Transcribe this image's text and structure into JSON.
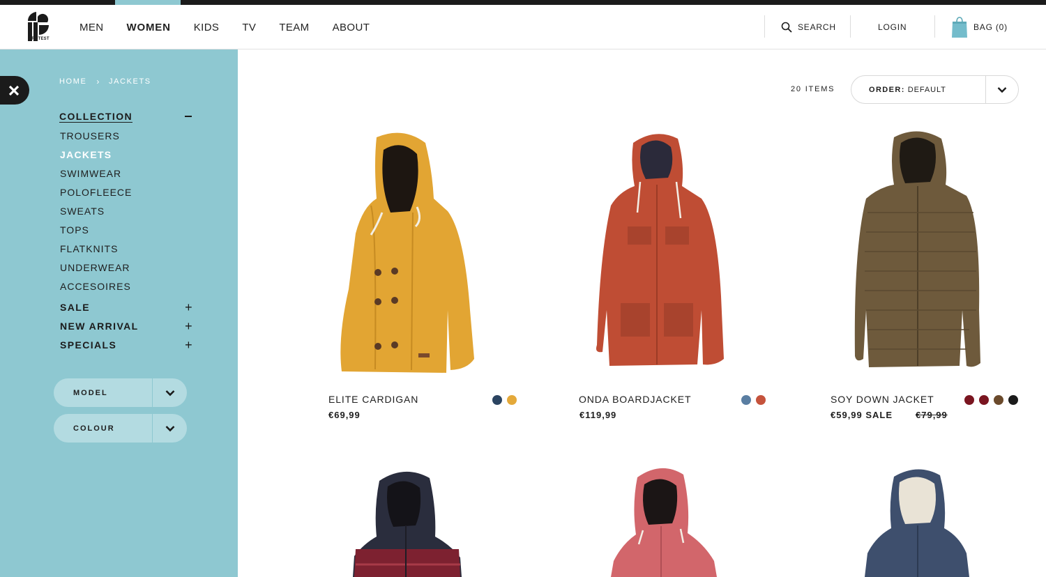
{
  "brand": {
    "name": "PROTEST"
  },
  "nav": {
    "items": [
      {
        "label": "MEN"
      },
      {
        "label": "WOMEN"
      },
      {
        "label": "KIDS"
      },
      {
        "label": "TV"
      },
      {
        "label": "TEAM"
      },
      {
        "label": "ABOUT"
      }
    ],
    "active": "WOMEN"
  },
  "header": {
    "search_label": "SEARCH",
    "login_label": "LOGIN",
    "bag_label": "BAG (0)"
  },
  "sidebar": {
    "breadcrumb": {
      "home": "HOME",
      "separator": "›",
      "current": "JACKETS"
    },
    "collection": {
      "label": "COLLECTION",
      "items": [
        {
          "label": "TROUSERS"
        },
        {
          "label": "JACKETS",
          "active": true
        },
        {
          "label": "SWIMWEAR"
        },
        {
          "label": "POLOFLEECE"
        },
        {
          "label": "SWEATS"
        },
        {
          "label": "TOPS"
        },
        {
          "label": "FLATKNITS"
        },
        {
          "label": "UNDERWEAR"
        },
        {
          "label": "ACCESOIRES"
        }
      ]
    },
    "categories": [
      {
        "label": "SALE",
        "toggle": "+"
      },
      {
        "label": "NEW ARRIVAL",
        "toggle": "+"
      },
      {
        "label": "SPECIALS",
        "toggle": "+"
      }
    ],
    "filters": [
      {
        "label": "MODEL"
      },
      {
        "label": "COLOUR"
      }
    ]
  },
  "listing": {
    "count_label": "20 ITEMS",
    "order": {
      "prefix": "ORDER:",
      "value": "DEFAULT"
    }
  },
  "products": [
    {
      "name": "ELITE CARDIGAN",
      "price": "€69,99",
      "image": "mustard-hooded-cardigan",
      "color": "#e2a533",
      "swatches": [
        "#2b4461",
        "#e4a93a"
      ]
    },
    {
      "name": "ONDA BOARDJACKET",
      "price": "€119,99",
      "image": "rust-boardjacket",
      "color": "#bf4d34",
      "swatches": [
        "#5a7ea2",
        "#c5533c"
      ]
    },
    {
      "name": "SOY DOWN JACKET",
      "price": "€59,99 SALE",
      "old_price": "€79,99",
      "image": "brown-down-jacket",
      "color": "#6e5a3c",
      "swatches": [
        "#7a1520",
        "#7a1520",
        "#6b4a2c",
        "#1b1b1b"
      ]
    },
    {
      "name": "",
      "price": "",
      "image": "burgundy-navy-vest",
      "color": "#7d2130",
      "swatches": []
    },
    {
      "name": "",
      "price": "",
      "image": "pink-ski-jacket",
      "color": "#d2666b",
      "swatches": []
    },
    {
      "name": "",
      "price": "",
      "image": "navy-parka",
      "color": "#3e4f6d",
      "swatches": []
    }
  ],
  "colors": {
    "accent": "#8ec8d1",
    "dark": "#1b1b1b",
    "filter_bg": "#b3dbe1"
  }
}
